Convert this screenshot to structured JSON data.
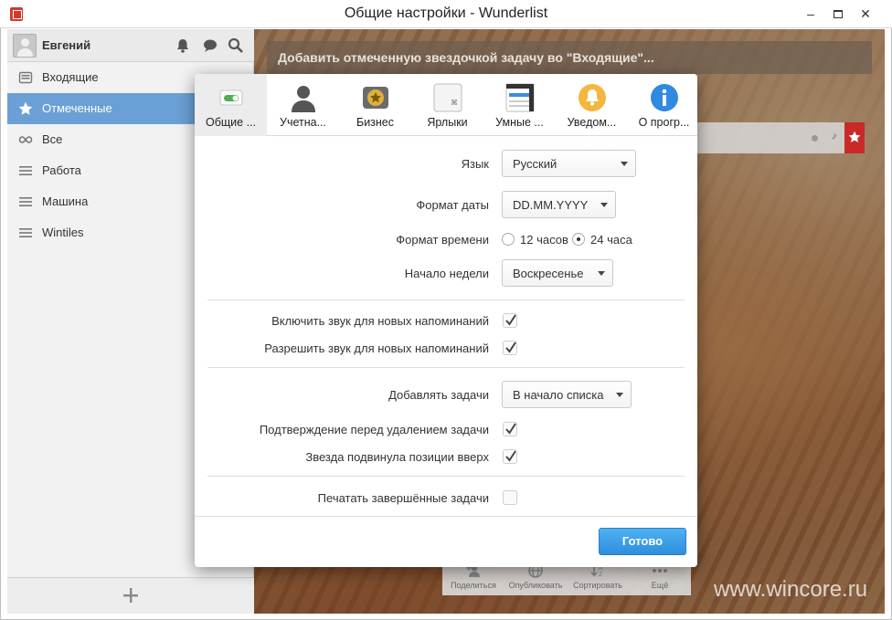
{
  "window": {
    "title": "Общие настройки - Wunderlist",
    "minimize": "–",
    "close": "✕"
  },
  "sidebar": {
    "user_name": "Евгений",
    "items": [
      {
        "label": "Входящие",
        "icon": "inbox-icon",
        "active": false
      },
      {
        "label": "Отмеченные",
        "icon": "star-icon",
        "active": true
      },
      {
        "label": "Все",
        "icon": "infinity-icon",
        "active": false
      },
      {
        "label": "Работа",
        "icon": "list-icon",
        "active": false
      },
      {
        "label": "Машина",
        "icon": "list-icon",
        "active": false
      },
      {
        "label": "Wintiles",
        "icon": "list-icon",
        "active": false
      }
    ],
    "add_label": "+"
  },
  "main": {
    "add_task_placeholder": "Добавить отмеченную звездочкой задачу во \"Входящие\"...",
    "toolbar": [
      {
        "label": "Поделиться",
        "icon": "share-icon"
      },
      {
        "label": "Опубликовать",
        "icon": "globe-icon"
      },
      {
        "label": "Сортировать",
        "icon": "sort-icon"
      },
      {
        "label": "Ещё",
        "icon": "more-icon"
      }
    ],
    "watermark": "www.wincore.ru"
  },
  "dialog": {
    "tabs": [
      {
        "label": "Общие ...",
        "icon": "toggle-icon",
        "active": true
      },
      {
        "label": "Учетна...",
        "icon": "account-icon",
        "active": false
      },
      {
        "label": "Бизнес",
        "icon": "business-icon",
        "active": false
      },
      {
        "label": "Ярлыки",
        "icon": "shortcuts-icon",
        "active": false
      },
      {
        "label": "Умные ...",
        "icon": "smart-lists-icon",
        "active": false
      },
      {
        "label": "Уведом...",
        "icon": "notifications-icon",
        "active": false
      },
      {
        "label": "О прогр...",
        "icon": "info-icon",
        "active": false
      }
    ],
    "language": {
      "label": "Язык",
      "value": "Русский"
    },
    "date_format": {
      "label": "Формат даты",
      "value": "DD.MM.YYYY"
    },
    "time_format": {
      "label": "Формат времени",
      "option_12": "12 часов",
      "option_24": "24 часа",
      "selected": "24 часа"
    },
    "week_start": {
      "label": "Начало недели",
      "value": "Воскресенье"
    },
    "sound_new_reminders": {
      "label": "Включить звук для новых напоминаний",
      "checked": true
    },
    "allow_sound_reminders": {
      "label": "Разрешить звук для новых напоминаний",
      "checked": true
    },
    "add_tasks": {
      "label": "Добавлять задачи",
      "value": "В начало списка"
    },
    "confirm_delete": {
      "label": "Подтверждение перед удалением задачи",
      "checked": true
    },
    "star_moves_up": {
      "label": "Звезда подвинула позиции вверх",
      "checked": true
    },
    "print_completed": {
      "label": "Печатать завершённые задачи",
      "checked": false
    },
    "done_label": "Готово"
  },
  "colors": {
    "accent": "#2e8fdc",
    "sidebar_active": "#6aa0d6",
    "flag": "#c82a2a"
  }
}
